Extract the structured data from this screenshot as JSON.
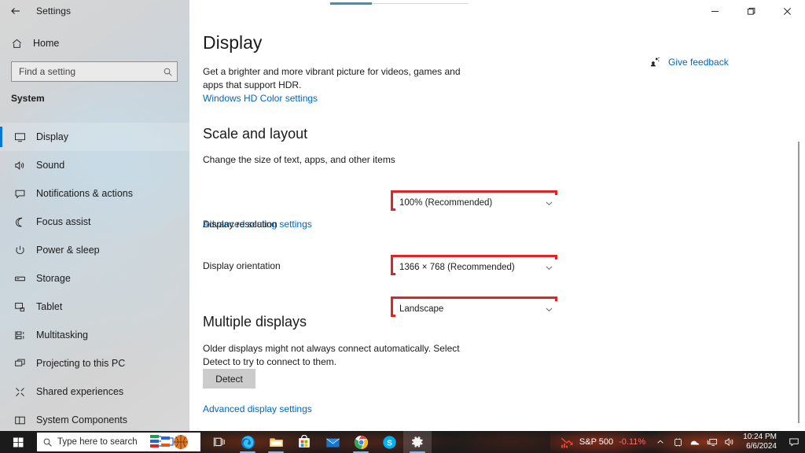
{
  "window": {
    "title": "Settings",
    "back_icon": "back-arrow-icon",
    "controls": [
      {
        "name": "minimize",
        "glyph": "—"
      },
      {
        "name": "maximize",
        "glyph": "❐"
      },
      {
        "name": "close",
        "glyph": "✕"
      }
    ]
  },
  "sidebar": {
    "home_label": "Home",
    "home_icon": "home-icon",
    "search": {
      "placeholder": "Find a setting",
      "value": "",
      "icon": "search-icon"
    },
    "section_label": "System",
    "items": [
      {
        "label": "Display",
        "icon": "monitor-icon",
        "selected": true
      },
      {
        "label": "Sound",
        "icon": "speaker-icon",
        "selected": false
      },
      {
        "label": "Notifications & actions",
        "icon": "notification-icon",
        "selected": false
      },
      {
        "label": "Focus assist",
        "icon": "moon-icon",
        "selected": false
      },
      {
        "label": "Power & sleep",
        "icon": "power-icon",
        "selected": false
      },
      {
        "label": "Storage",
        "icon": "storage-icon",
        "selected": false
      },
      {
        "label": "Tablet",
        "icon": "tablet-icon",
        "selected": false
      },
      {
        "label": "Multitasking",
        "icon": "multitasking-icon",
        "selected": false
      },
      {
        "label": "Projecting to this PC",
        "icon": "projecting-icon",
        "selected": false
      },
      {
        "label": "Shared experiences",
        "icon": "share-icon",
        "selected": false
      },
      {
        "label": "System Components",
        "icon": "components-icon",
        "selected": false
      }
    ]
  },
  "main": {
    "page_title": "Display",
    "hdr_paragraph": "Get a brighter and more vibrant picture for videos, games and apps that support HDR.",
    "hdr_link": "Windows HD Color settings",
    "feedback_label": "Give feedback",
    "feedback_icon": "feedback-person-icon",
    "scale_section": {
      "title": "Scale and layout",
      "scale_label": "Change the size of text, apps, and other items",
      "scale_value": "100% (Recommended)",
      "advanced_scaling_link": "Advanced scaling settings",
      "resolution_label": "Display resolution",
      "resolution_value": "1366 × 768 (Recommended)",
      "orientation_label": "Display orientation",
      "orientation_value": "Landscape",
      "highlight_color": "#e02424"
    },
    "multiple_section": {
      "title": "Multiple displays",
      "paragraph": "Older displays might not always connect automatically. Select Detect to try to connect to them.",
      "detect_label": "Detect",
      "advanced_display_link": "Advanced display settings"
    }
  },
  "taskbar": {
    "start_icon": "windows-start-icon",
    "search": {
      "placeholder": "Type here to search",
      "value": "",
      "icon": "search-icon",
      "badge_icon": "bracket-basketball-icon"
    },
    "apps": [
      {
        "name": "task-view",
        "icon": "task-view-icon",
        "active": false
      },
      {
        "name": "edge",
        "icon": "edge-icon",
        "active": false,
        "running": true
      },
      {
        "name": "file-explorer",
        "icon": "folder-icon",
        "active": false,
        "running": true
      },
      {
        "name": "microsoft-store",
        "icon": "store-icon",
        "active": false,
        "running": false
      },
      {
        "name": "mail",
        "icon": "mail-icon",
        "active": false,
        "running": false
      },
      {
        "name": "chrome",
        "icon": "chrome-icon",
        "active": false,
        "running": true
      },
      {
        "name": "skype",
        "icon": "skype-icon",
        "active": false,
        "running": false
      },
      {
        "name": "settings",
        "icon": "gear-icon",
        "active": true,
        "running": true
      }
    ],
    "stock": {
      "icon": "stock-down-icon",
      "name": "S&P 500",
      "change": "-0.11%",
      "change_color": "#ff6b6b"
    },
    "tray_icons": [
      {
        "name": "show-hidden-icons",
        "icon": "chevron-up-icon"
      },
      {
        "name": "onedrive",
        "icon": "onedrive-icon"
      },
      {
        "name": "cloud-sync",
        "icon": "cloud-icon"
      },
      {
        "name": "network",
        "icon": "network-monitor-icon"
      },
      {
        "name": "volume",
        "icon": "speaker-icon"
      }
    ],
    "clock": {
      "time": "10:24 PM",
      "date": "6/6/2024"
    },
    "action_center_icon": "action-center-icon"
  }
}
